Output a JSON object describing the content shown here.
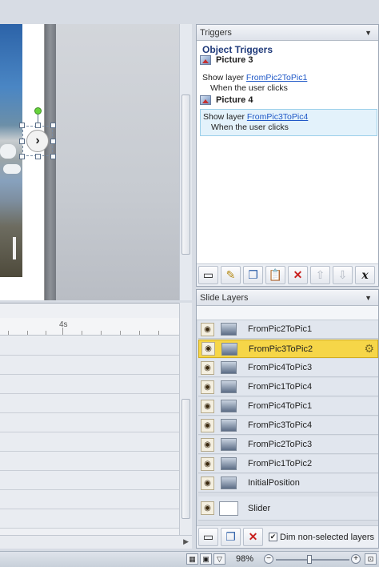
{
  "triggers": {
    "header": "Triggers",
    "title": "Object Triggers",
    "objects": [
      {
        "name": "Picture 3",
        "action": "Show layer",
        "layer": "FromPic2ToPic1",
        "condition": "When the user clicks"
      },
      {
        "name": "Picture 4",
        "action": "Show layer",
        "layer": "FromPic3ToPic4",
        "condition": "When the user clicks"
      }
    ],
    "toolbar": {
      "new_icon": "new-trigger-icon",
      "edit_icon": "edit-trigger-icon",
      "copy_icon": "copy-icon",
      "paste_icon": "paste-icon",
      "delete_icon": "delete-icon",
      "up_icon": "move-up-icon",
      "down_icon": "move-down-icon",
      "close_label": "x"
    }
  },
  "timeline": {
    "ruler_label": "4s"
  },
  "layers": {
    "header": "Slide Layers",
    "items": [
      {
        "name": "FromPic2ToPic1",
        "selected": false
      },
      {
        "name": "FromPic3ToPic2",
        "selected": true
      },
      {
        "name": "FromPic4ToPic3",
        "selected": false
      },
      {
        "name": "FromPic1ToPic4",
        "selected": false
      },
      {
        "name": "FromPic4ToPic1",
        "selected": false
      },
      {
        "name": "FromPic3ToPic4",
        "selected": false
      },
      {
        "name": "FromPic2ToPic3",
        "selected": false
      },
      {
        "name": "FromPic1ToPic2",
        "selected": false
      },
      {
        "name": "InitialPosition",
        "selected": false
      },
      {
        "name": "Slider",
        "selected": false,
        "base": true
      }
    ],
    "dim_label": "Dim non-selected layers",
    "dim_checked": true
  },
  "status": {
    "zoom": "98%",
    "zoom_level": 0.5
  },
  "canvas": {
    "next_button_glyph": "›"
  },
  "colors": {
    "selected_layer": "#f6d648",
    "link": "#1f58c7",
    "selected_trigger": "#e3f2fb"
  }
}
